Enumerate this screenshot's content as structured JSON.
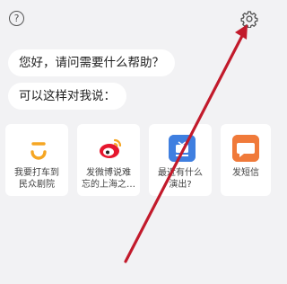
{
  "header": {
    "help_glyph": "?",
    "help_icon": "question-circle-icon",
    "settings_icon": "gear-icon"
  },
  "chat": {
    "greeting": "您好，请问需要什么帮助？",
    "prompt": "可以这样对我说："
  },
  "cards": [
    {
      "label": "我要打车到\n民众剧院",
      "icon": "didi-icon",
      "color": "#f5a623"
    },
    {
      "label": "发微博说难\n忘的上海之…",
      "icon": "weibo-icon",
      "color": "#e6162d"
    },
    {
      "label": "最近有什么\n演出?",
      "icon": "show-icon",
      "color": "#3f7fe0"
    },
    {
      "label": "发短信",
      "icon": "sms-icon",
      "color": "#f07a3a"
    }
  ],
  "colors": {
    "background": "#f2f2f4",
    "annotation_arrow": "#c21a2b"
  }
}
